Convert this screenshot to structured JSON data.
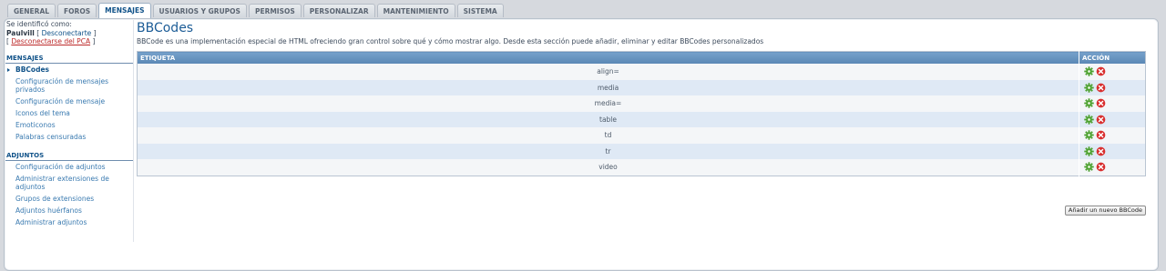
{
  "tabs": [
    "GENERAL",
    "FOROS",
    "MENSAJES",
    "USUARIOS Y GRUPOS",
    "PERMISOS",
    "PERSONALIZAR",
    "MANTENIMIENTO",
    "SISTEMA"
  ],
  "active_tab": "MENSAJES",
  "user": {
    "identified_label": "Se identificó como:",
    "username": "Paulvill",
    "logout_label": "Desconectarte",
    "logout_acp_label": "Desconectarse del PCA"
  },
  "sidebar": {
    "mensajes_title": "MENSAJES",
    "mensajes_items": [
      "BBCodes",
      "Configuración de mensajes privados",
      "Configuración de mensaje",
      "Iconos del tema",
      "Emoticonos",
      "Palabras censuradas"
    ],
    "adjuntos_title": "ADJUNTOS",
    "adjuntos_items": [
      "Configuración de adjuntos",
      "Administrar extensiones de adjuntos",
      "Grupos de extensiones",
      "Adjuntos huérfanos",
      "Administrar adjuntos"
    ]
  },
  "main": {
    "title": "BBCodes",
    "description": "BBCode es una implementación especial de HTML ofreciendo gran control sobre qué y cómo mostrar algo. Desde esta sección puede añadir, eliminar y editar BBCodes personalizados",
    "col_label": "ETIQUETA",
    "col_action": "ACCIÓN",
    "rows": [
      "align=",
      "media",
      "media=",
      "table",
      "td",
      "tr",
      "video"
    ],
    "add_button": "Añadir un nuevo BBCode"
  },
  "icons": {
    "edit": "gear-icon",
    "delete": "delete-icon"
  },
  "colors": {
    "header_blue": "#5a87b4",
    "edit_green": "#4ca12f",
    "delete_red": "#d93030"
  }
}
